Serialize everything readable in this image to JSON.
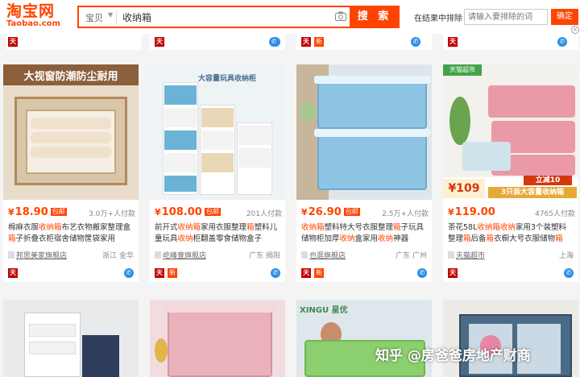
{
  "header": {
    "logo_main": "淘宝网",
    "logo_sub": "Taobao.com",
    "search_type": "宝贝",
    "search_query": "收纳箱",
    "search_button": "搜 索",
    "exclude_label": "在结果中排除",
    "exclude_placeholder": "请输入要排除的词",
    "exclude_button": "确定",
    "close": "×"
  },
  "row0": {
    "badge_tm": "天",
    "badge_new": "新"
  },
  "products": [
    {
      "price": "18.90",
      "tag": "包邮",
      "sales": "3.0万+人付款",
      "title": [
        {
          "t": "棉麻衣服",
          "h": false
        },
        {
          "t": "收纳箱",
          "h": true
        },
        {
          "t": "布艺衣物搬家整理盒",
          "h": false
        },
        {
          "t": "箱",
          "h": true
        },
        {
          "t": "子折叠衣柜宿舍储物筐袋家用",
          "h": false
        }
      ],
      "shop": "邦思美家旗舰店",
      "location": "浙江 金华",
      "thumb_text": "大视窗防潮防尘耐用",
      "badge_new": false
    },
    {
      "price": "108.00",
      "tag": "包邮",
      "sales": "201人付款",
      "title": [
        {
          "t": "前开式",
          "h": false
        },
        {
          "t": "收纳箱",
          "h": true
        },
        {
          "t": "家用衣服整理",
          "h": false
        },
        {
          "t": "箱",
          "h": true
        },
        {
          "t": "塑料儿童玩具",
          "h": false
        },
        {
          "t": "收纳",
          "h": true
        },
        {
          "t": "柜翻盖零食储物盒子",
          "h": false
        }
      ],
      "shop": "屹峰壹旗舰店",
      "location": "广东 揭阳",
      "thumb_text": "大容量玩具收纳柜",
      "badge_new": true
    },
    {
      "price": "26.90",
      "tag": "包邮",
      "sales": "2.5万+人付款",
      "title": [
        {
          "t": "收纳箱",
          "h": true
        },
        {
          "t": "塑料特大号衣服整理",
          "h": false
        },
        {
          "t": "箱",
          "h": true
        },
        {
          "t": "子玩具储物柜加厚",
          "h": false
        },
        {
          "t": "收纳",
          "h": true
        },
        {
          "t": "盒家用",
          "h": false
        },
        {
          "t": "收纳",
          "h": true
        },
        {
          "t": "神器",
          "h": false
        }
      ],
      "shop": "也逛旗舰店",
      "location": "广东 广州",
      "thumb_text": "",
      "badge_new": true
    },
    {
      "price": "119.00",
      "tag": "",
      "sales": "4765人付款",
      "title": [
        {
          "t": "茶花58L",
          "h": false
        },
        {
          "t": "收纳箱收纳",
          "h": true
        },
        {
          "t": "家用3个装塑料整理",
          "h": false
        },
        {
          "t": "箱",
          "h": true
        },
        {
          "t": "后备",
          "h": false
        },
        {
          "t": "箱",
          "h": true
        },
        {
          "t": "衣橱大号衣服储物",
          "h": false
        },
        {
          "t": "箱",
          "h": true
        }
      ],
      "shop": "天猫超市",
      "location": "上海",
      "thumb_text": "3只装大容量收纳箱",
      "thumb_promo": "立减10",
      "thumb_price": "¥109",
      "thumb_brand": "天猫超市",
      "badge_new": false
    }
  ],
  "watermark": "知乎 @房爸爸房地产财商",
  "bottom_brand": "XINGU 星优",
  "currency": "¥",
  "colors": {
    "accent": "#ff4400",
    "tmall": "#c40000",
    "chat": "#2e8ee8"
  }
}
